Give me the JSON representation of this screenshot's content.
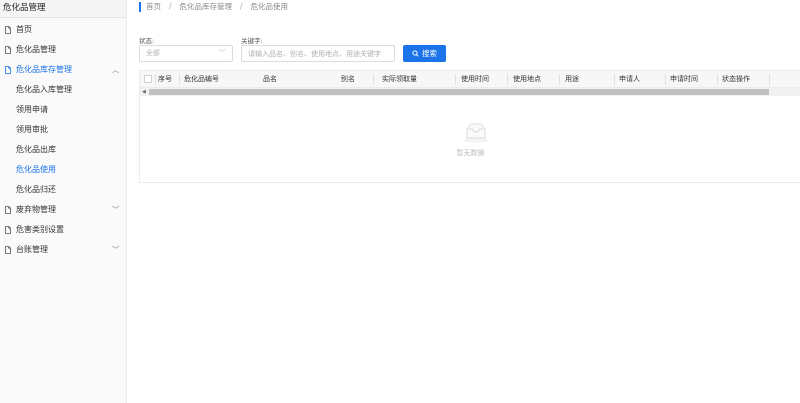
{
  "sidebar": {
    "title": "危化品管理",
    "items": [
      {
        "label": "首页",
        "icon": "document-icon"
      },
      {
        "label": "危化品管理",
        "icon": "document-icon"
      },
      {
        "label": "危化品库存管理",
        "icon": "document-icon",
        "expanded": true,
        "active": true
      },
      {
        "label": "废弃物管理",
        "icon": "document-icon"
      },
      {
        "label": "危害类别设置",
        "icon": "document-icon"
      },
      {
        "label": "台账管理",
        "icon": "document-icon"
      }
    ],
    "subitems": [
      {
        "label": "危化品入库管理"
      },
      {
        "label": "领用申请"
      },
      {
        "label": "领用审批"
      },
      {
        "label": "危化品出库"
      },
      {
        "label": "危化品使用",
        "selected": true
      },
      {
        "label": "危化品归还"
      }
    ]
  },
  "breadcrumb": [
    "首页",
    "危化品库存管理",
    "危化品使用"
  ],
  "filters": {
    "status_label": "状态:",
    "status_value": "全部",
    "keyword_label": "关键字:",
    "keyword_placeholder": "请输入品名、别名、使用地点、用途关键字",
    "search_label": "搜索"
  },
  "table": {
    "columns": [
      "序号",
      "危化品编号",
      "品名",
      "别名",
      "实际领取量",
      "使用时间",
      "使用地点",
      "用途",
      "申请人",
      "申请时间",
      "状态操作"
    ],
    "rows": [],
    "empty_text": "暂无数据"
  },
  "colors": {
    "accent": "#1a73e8",
    "sidebar_bg": "#fafafa",
    "header_bg": "#f7f7f7"
  }
}
